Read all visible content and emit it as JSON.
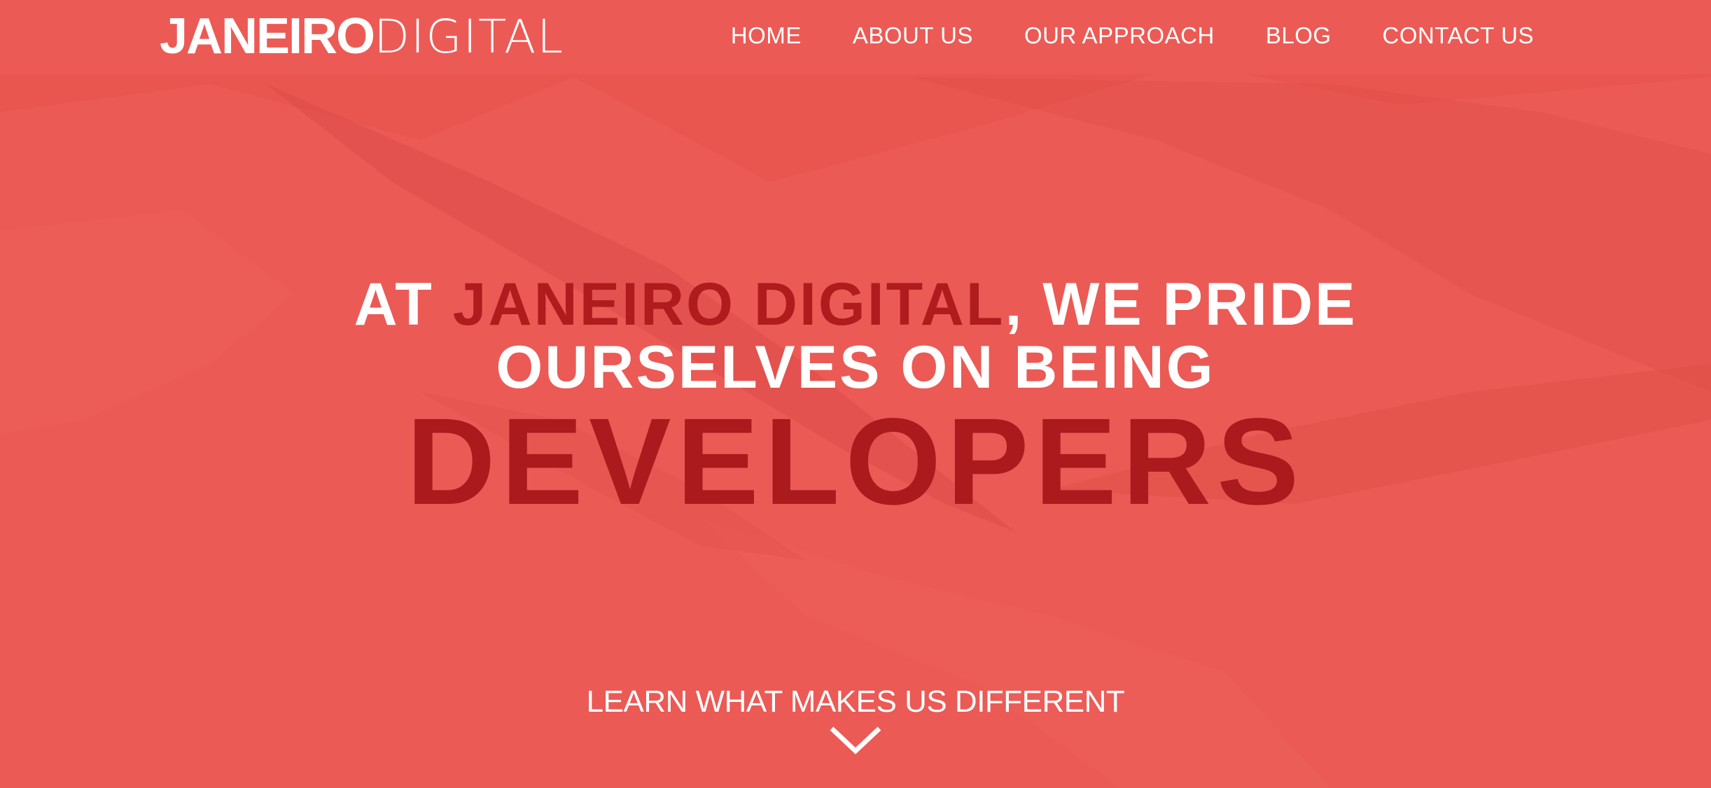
{
  "brand": {
    "logo_bold": "JANEIRO",
    "logo_light": "DIGITAL",
    "background_color": "#eb5a55",
    "accent_color": "#ab1a1c",
    "text_color": "#ffffff"
  },
  "nav": {
    "items": [
      {
        "label": "HOME"
      },
      {
        "label": "ABOUT US"
      },
      {
        "label": "OUR APPROACH"
      },
      {
        "label": "BLOG"
      },
      {
        "label": "CONTACT US"
      }
    ]
  },
  "hero": {
    "line1_prefix": "AT ",
    "line1_accent": "JANEIRO DIGITAL",
    "line1_suffix": ", WE PRIDE",
    "line2": "OURSELVES ON BEING",
    "big_word": "DEVELOPERS"
  },
  "cta": {
    "label": "LEARN WHAT MAKES US DIFFERENT",
    "icon": "chevron-down-icon"
  }
}
